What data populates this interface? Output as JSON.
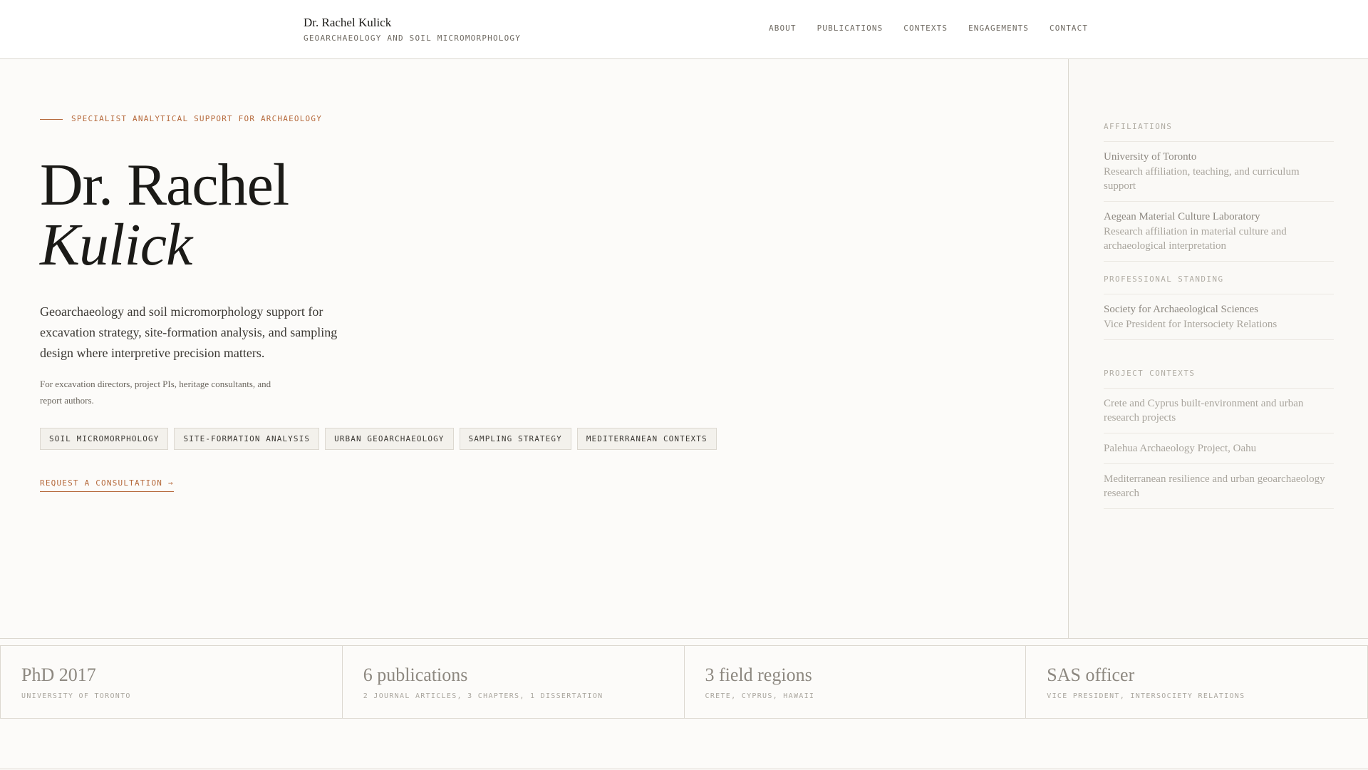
{
  "header": {
    "name": "Dr. Rachel Kulick",
    "subtitle": "GEOARCHAEOLOGY AND SOIL MICROMORPHOLOGY",
    "nav": [
      "ABOUT",
      "PUBLICATIONS",
      "CONTEXTS",
      "ENGAGEMENTS",
      "CONTACT"
    ]
  },
  "hero": {
    "eyebrow": "SPECIALIST ANALYTICAL SUPPORT FOR ARCHAEOLOGY",
    "title_line1": "Dr. Rachel",
    "title_line2": "Kulick",
    "lead": "Geoarchaeology and soil micromorphology support for excavation strategy, site-formation analysis, and sampling design where interpretive precision matters.",
    "audience": "For excavation directors, project PIs, heritage consultants, and report authors.",
    "tags": [
      "SOIL MICROMORPHOLOGY",
      "SITE-FORMATION ANALYSIS",
      "URBAN GEOARCHAEOLOGY",
      "SAMPLING STRATEGY",
      "MEDITERRANEAN CONTEXTS"
    ],
    "cta": "REQUEST A CONSULTATION →"
  },
  "sidebar": {
    "affiliations": {
      "heading": "AFFILIATIONS",
      "items": [
        {
          "title": "University of Toronto",
          "desc": "Research affiliation, teaching, and curriculum support"
        },
        {
          "title": "Aegean Material Culture Laboratory",
          "desc": "Research affiliation in material culture and archaeological interpretation"
        }
      ]
    },
    "standing": {
      "heading": "PROFESSIONAL STANDING",
      "items": [
        {
          "title": "Society for Archaeological Sciences",
          "desc": "Vice President for Intersociety Relations"
        }
      ]
    },
    "contexts": {
      "heading": "PROJECT CONTEXTS",
      "items": [
        "Crete and Cyprus built-environment and urban research projects",
        "Palehua Archaeology Project, Oahu",
        "Mediterranean resilience and urban geoarchaeology research"
      ]
    }
  },
  "stats": [
    {
      "value": "PhD 2017",
      "label": "UNIVERSITY OF TORONTO"
    },
    {
      "value": "6 publications",
      "label": "2 JOURNAL ARTICLES, 3 CHAPTERS, 1 DISSERTATION"
    },
    {
      "value": "3 field regions",
      "label": "CRETE, CYPRUS, HAWAII"
    },
    {
      "value": "SAS officer",
      "label": "VICE PRESIDENT, INTERSOCIETY RELATIONS"
    }
  ],
  "colors": {
    "accent": "#b5693b",
    "background": "#fcfbf9",
    "text": "#1b1a17",
    "border": "#dcd8d0"
  }
}
